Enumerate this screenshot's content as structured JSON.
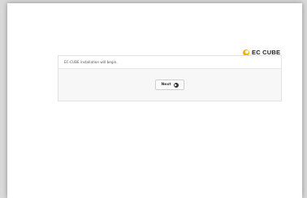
{
  "brand": {
    "logo_text": "EC CUBE",
    "logo_icon": "ec-cube-logo-mark",
    "accent": "#f5b400"
  },
  "installer": {
    "message": "EC-CUBE installation will begin.",
    "next_label": "Next",
    "next_icon": "chevron-right-circle-icon"
  }
}
